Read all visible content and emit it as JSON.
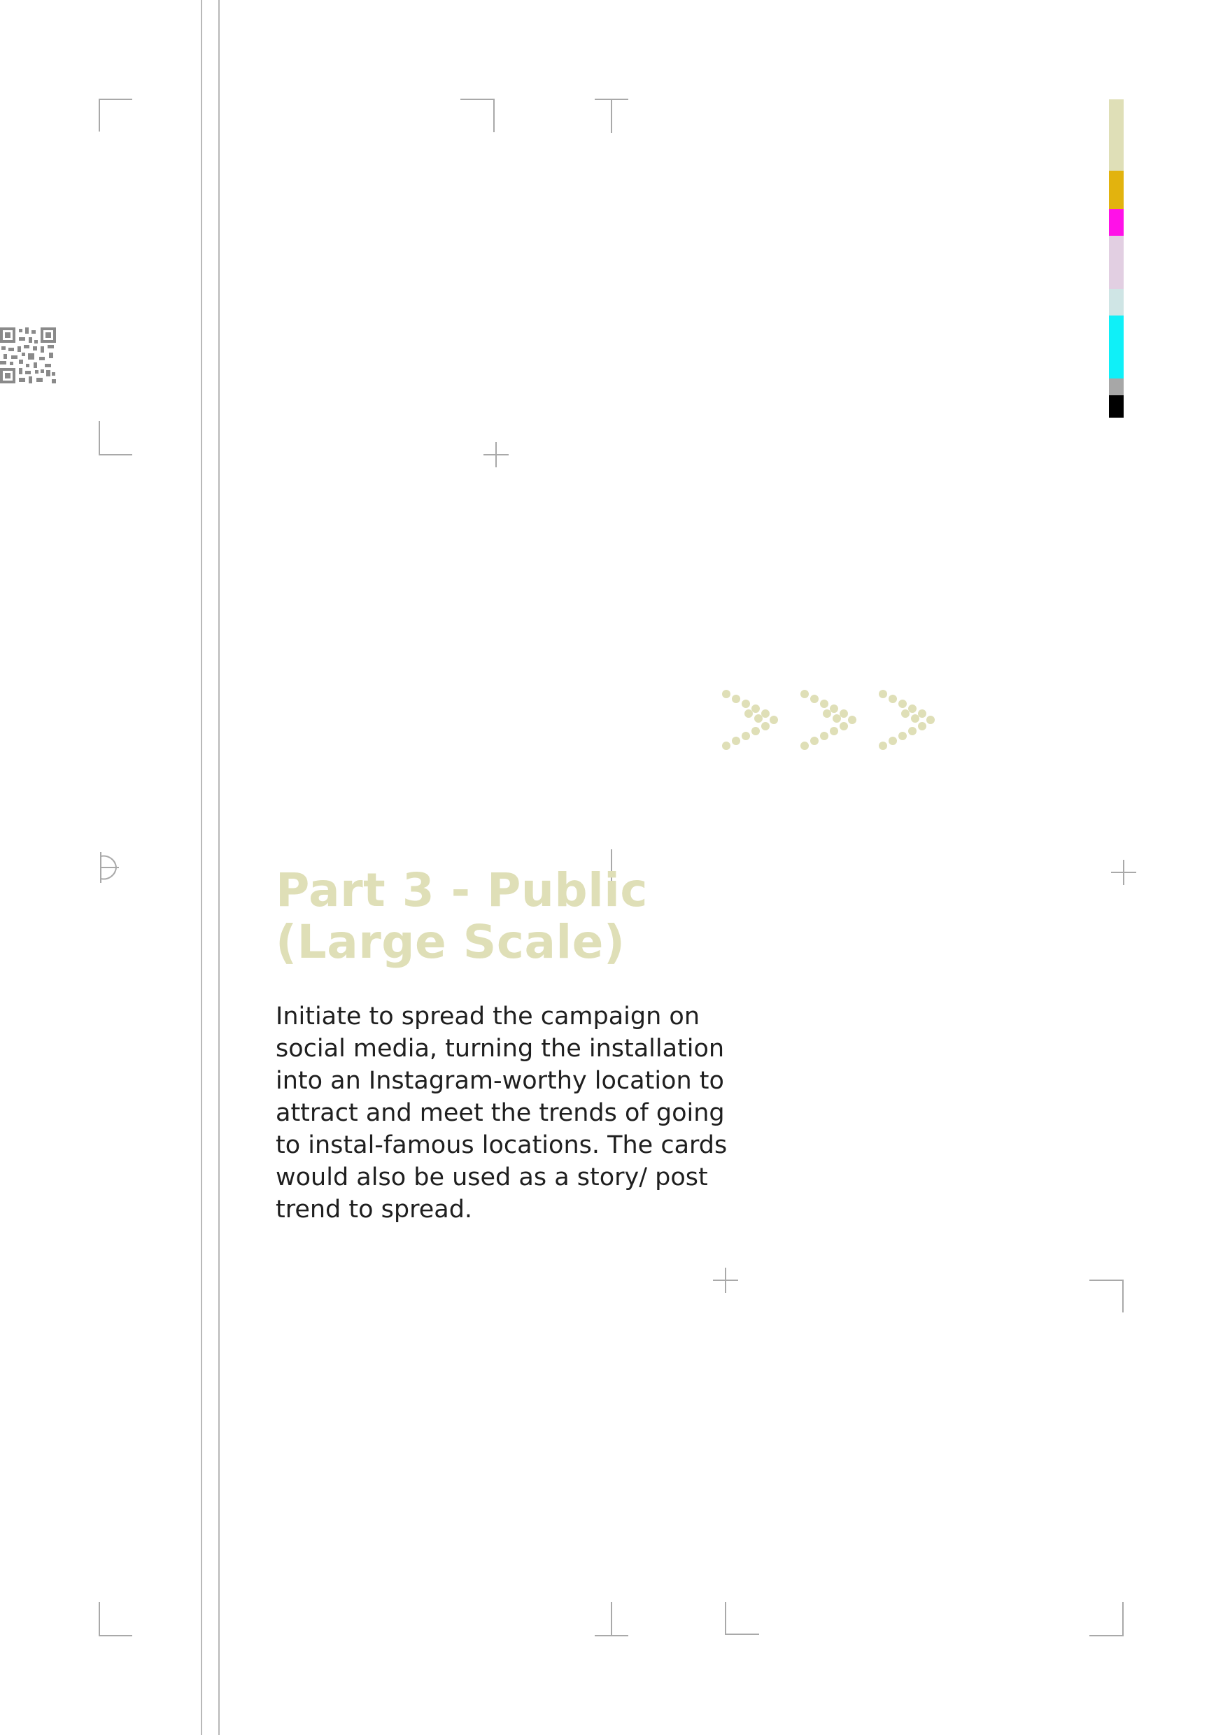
{
  "heading": {
    "line1": "Part 3 - Public",
    "line2": "(Large Scale)"
  },
  "body_lines": [
    "Initiate to spread the campaign on",
    "social media, turning the installation",
    "into an Instagram-worthy location to",
    "attract and meet the trends of going",
    "to instal-famous locations. The cards",
    "would also be used as a story/ post",
    "trend to spread."
  ],
  "colors": {
    "heading": "#dfdfb7",
    "body_text": "#1f1f1f",
    "accent_dots": "#dfdfb7",
    "guide_lines": "#b8b8b8"
  },
  "color_bar": [
    "#dfdfb7",
    "#e2b30e",
    "#ff11e8",
    "#e2cfe2",
    "#cfe5e5",
    "#0ff0f8",
    "#a7a7a7",
    "#000000"
  ],
  "icons": {
    "qr": "qr-code-icon",
    "arrows": "triple-chevron-right-icon"
  }
}
